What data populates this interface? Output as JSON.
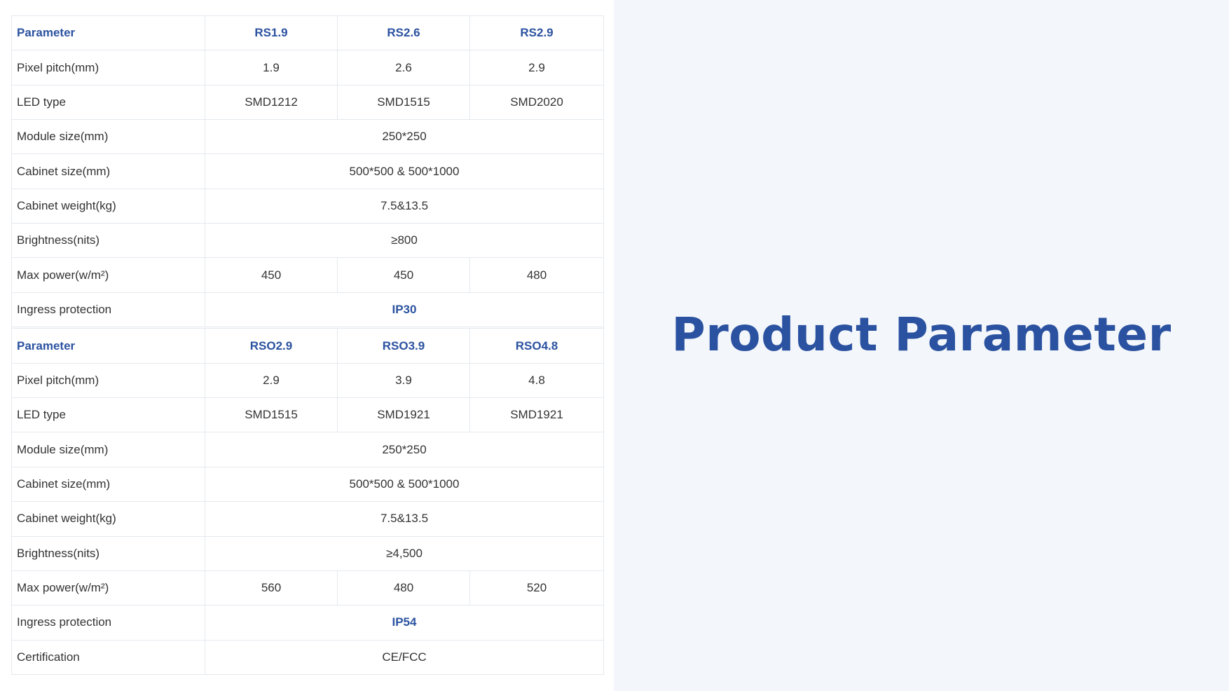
{
  "title": "Product Parameter",
  "colors": {
    "accent": "#2b52a0",
    "text": "#333333",
    "border": "#e4e8ee",
    "right_background": "#f3f6fb"
  },
  "table1": {
    "header": [
      "Parameter",
      "RS1.9",
      "RS2.6",
      "RS2.9"
    ],
    "rows": [
      {
        "label": "Pixel pitch(mm)",
        "values": [
          "1.9",
          "2.6",
          "2.9"
        ]
      },
      {
        "label": "LED type",
        "values": [
          "SMD1212",
          "SMD1515",
          "SMD2020"
        ]
      },
      {
        "label": "Module size(mm)",
        "values": [
          "250*250"
        ]
      },
      {
        "label": "Cabinet size(mm)",
        "values": [
          "500*500 & 500*1000"
        ]
      },
      {
        "label": "Cabinet weight(kg)",
        "values": [
          "7.5&13.5"
        ]
      },
      {
        "label": "Brightness(nits)",
        "values": [
          "≥800"
        ]
      },
      {
        "label": "Max power(w/m²)",
        "values": [
          "450",
          "450",
          "480"
        ]
      },
      {
        "label": "Ingress protection",
        "values": [
          "IP30"
        ]
      }
    ]
  },
  "table2": {
    "header": [
      "Parameter",
      "RSO2.9",
      "RSO3.9",
      "RSO4.8"
    ],
    "rows": [
      {
        "label": "Pixel pitch(mm)",
        "values": [
          "2.9",
          "3.9",
          "4.8"
        ]
      },
      {
        "label": "LED type",
        "values": [
          "SMD1515",
          "SMD1921",
          "SMD1921"
        ]
      },
      {
        "label": "Module size(mm)",
        "values": [
          "250*250"
        ]
      },
      {
        "label": "Cabinet size(mm)",
        "values": [
          "500*500 & 500*1000"
        ]
      },
      {
        "label": "Cabinet weight(kg)",
        "values": [
          "7.5&13.5"
        ]
      },
      {
        "label": "Brightness(nits)",
        "values": [
          "≥4,500"
        ]
      },
      {
        "label": "Max power(w/m²)",
        "values": [
          "560",
          "480",
          "520"
        ]
      },
      {
        "label": "Ingress protection",
        "values": [
          "IP54"
        ]
      },
      {
        "label": "Certification",
        "values": [
          "CE/FCC"
        ]
      }
    ]
  }
}
